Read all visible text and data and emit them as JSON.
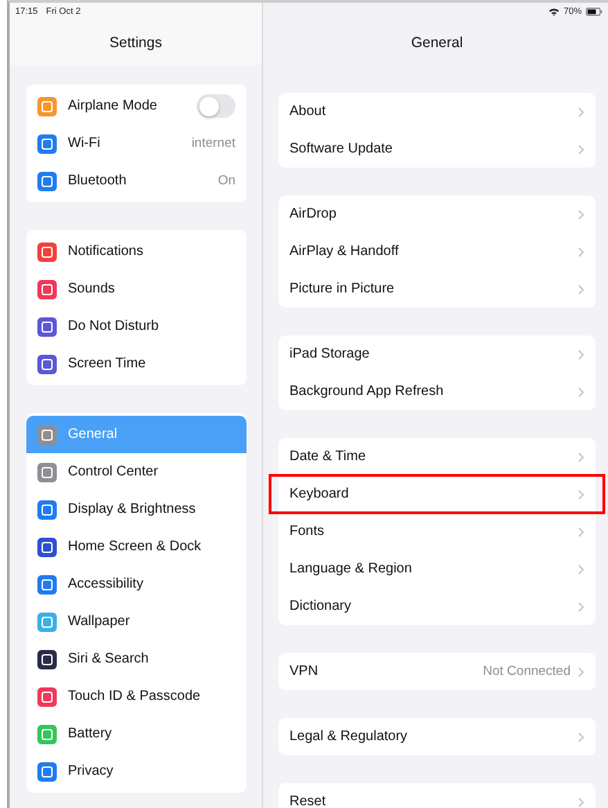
{
  "status_bar": {
    "time": "17:15",
    "date": "Fri Oct 2",
    "battery": "70%"
  },
  "sidebar": {
    "title": "Settings",
    "groups": [
      [
        {
          "label": "Airplane Mode",
          "kind": "toggle",
          "on": false,
          "selected": false,
          "color": "#f7962b"
        },
        {
          "label": "Wi-Fi",
          "kind": "value",
          "value": "internet",
          "selected": false,
          "color": "#1f7cf2"
        },
        {
          "label": "Bluetooth",
          "kind": "value",
          "value": "On",
          "selected": false,
          "color": "#1f7cf2"
        }
      ],
      [
        {
          "label": "Notifications",
          "kind": "plain",
          "selected": false,
          "color": "#f2413c"
        },
        {
          "label": "Sounds",
          "kind": "plain",
          "selected": false,
          "color": "#f1385a"
        },
        {
          "label": "Do Not Disturb",
          "kind": "plain",
          "selected": false,
          "color": "#5b57d6"
        },
        {
          "label": "Screen Time",
          "kind": "plain",
          "selected": false,
          "color": "#5b57d6"
        }
      ],
      [
        {
          "label": "General",
          "kind": "plain",
          "selected": true,
          "color": "#8e8e93"
        },
        {
          "label": "Control Center",
          "kind": "plain",
          "selected": false,
          "color": "#8e8e93"
        },
        {
          "label": "Display & Brightness",
          "kind": "plain",
          "selected": false,
          "color": "#1f7cf2"
        },
        {
          "label": "Home Screen & Dock",
          "kind": "plain",
          "selected": false,
          "color": "#2d4fd0"
        },
        {
          "label": "Accessibility",
          "kind": "plain",
          "selected": false,
          "color": "#1f7cf2"
        },
        {
          "label": "Wallpaper",
          "kind": "plain",
          "selected": false,
          "color": "#3ab0e6"
        },
        {
          "label": "Siri & Search",
          "kind": "plain",
          "selected": false,
          "color": "#2a2a4a"
        },
        {
          "label": "Touch ID & Passcode",
          "kind": "plain",
          "selected": false,
          "color": "#f1385a"
        },
        {
          "label": "Battery",
          "kind": "plain",
          "selected": false,
          "color": "#35c659"
        },
        {
          "label": "Privacy",
          "kind": "plain",
          "selected": false,
          "color": "#1f7cf2"
        }
      ]
    ]
  },
  "detail": {
    "title": "General",
    "groups": [
      [
        {
          "label": "About",
          "highlighted": false
        },
        {
          "label": "Software Update",
          "highlighted": false
        }
      ],
      [
        {
          "label": "AirDrop",
          "highlighted": false
        },
        {
          "label": "AirPlay & Handoff",
          "highlighted": false
        },
        {
          "label": "Picture in Picture",
          "highlighted": false
        }
      ],
      [
        {
          "label": "iPad Storage",
          "highlighted": false
        },
        {
          "label": "Background App Refresh",
          "highlighted": false
        }
      ],
      [
        {
          "label": "Date & Time",
          "highlighted": false
        },
        {
          "label": "Keyboard",
          "highlighted": true
        },
        {
          "label": "Fonts",
          "highlighted": false
        },
        {
          "label": "Language & Region",
          "highlighted": false
        },
        {
          "label": "Dictionary",
          "highlighted": false
        }
      ],
      [
        {
          "label": "VPN",
          "value": "Not Connected",
          "highlighted": false
        }
      ],
      [
        {
          "label": "Legal & Regulatory",
          "highlighted": false
        }
      ],
      [
        {
          "label": "Reset",
          "highlighted": false
        }
      ]
    ]
  }
}
